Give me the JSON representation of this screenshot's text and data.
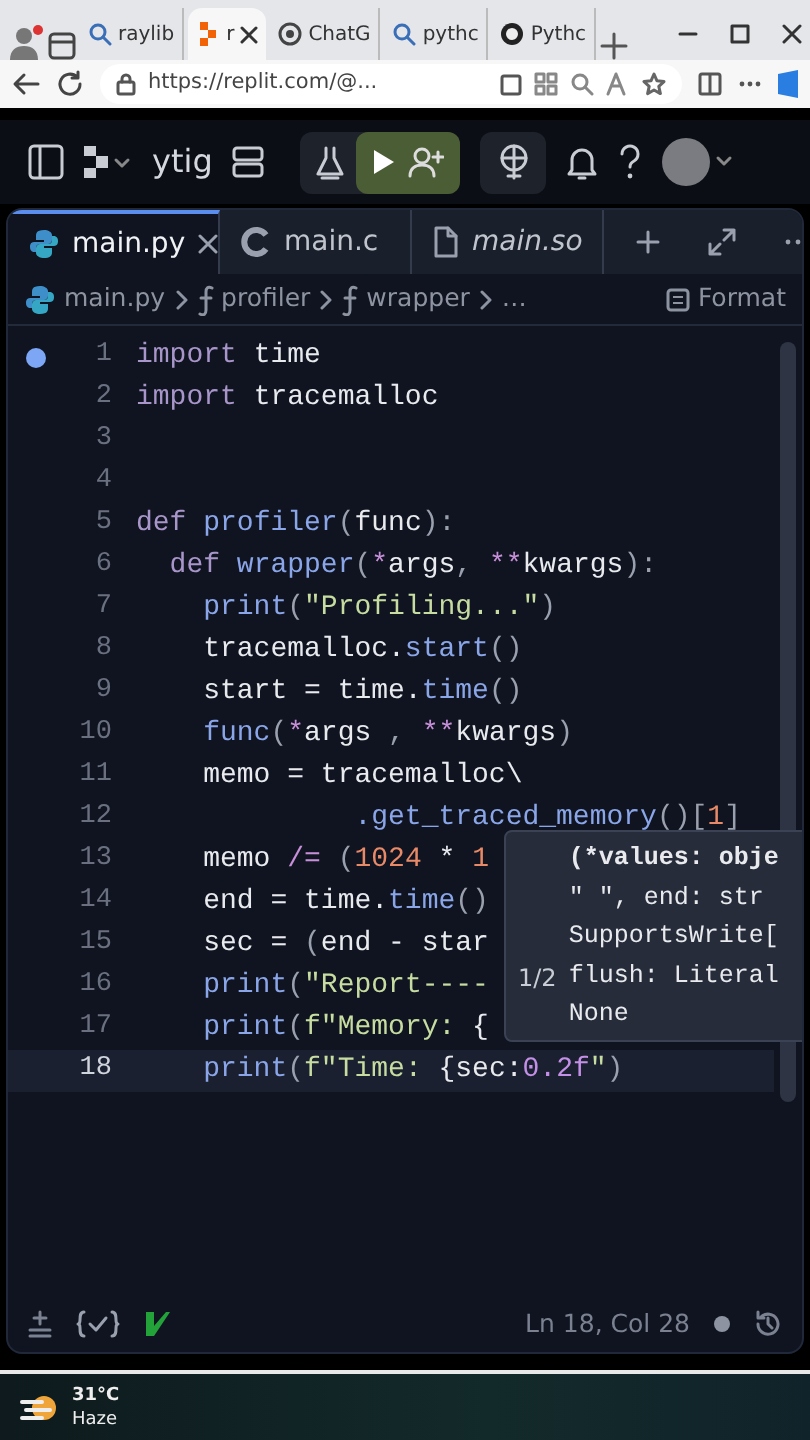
{
  "browser": {
    "tabs": [
      {
        "title": "raylib",
        "kind": "search",
        "selected": false
      },
      {
        "title": "r",
        "kind": "replit",
        "selected": true
      },
      {
        "title": "ChatG",
        "kind": "chatgpt",
        "selected": false
      },
      {
        "title": "pythc",
        "kind": "search",
        "selected": false
      },
      {
        "title": "Pythc",
        "kind": "github",
        "selected": false
      }
    ],
    "address": "https://replit.com/@..."
  },
  "header": {
    "repl_name": "ytig"
  },
  "editor_tabs": [
    {
      "label": "main.py",
      "kind": "python",
      "selected": true,
      "preview": false
    },
    {
      "label": "main.c",
      "kind": "c",
      "selected": false,
      "preview": false
    },
    {
      "label": "main.so",
      "kind": "file",
      "selected": false,
      "preview": true
    }
  ],
  "breadcrumb": [
    {
      "label": "main.py",
      "kind": "file"
    },
    {
      "label": "profiler",
      "kind": "function"
    },
    {
      "label": "wrapper",
      "kind": "function"
    },
    {
      "label": "…",
      "kind": "more"
    }
  ],
  "format_button": "Format",
  "code_lines": [
    {
      "number": "1",
      "dot": true,
      "selected": false,
      "tokens": [
        {
          "kind": "kw",
          "text": "import"
        },
        {
          "kind": "plain",
          "text": " time"
        }
      ]
    },
    {
      "number": "2",
      "dot": false,
      "selected": false,
      "tokens": [
        {
          "kind": "kw",
          "text": "import"
        },
        {
          "kind": "plain",
          "text": " tracemalloc"
        }
      ]
    },
    {
      "number": "3",
      "dot": false,
      "selected": false
    },
    {
      "number": "4",
      "dot": false,
      "selected": false
    },
    {
      "number": "5",
      "dot": false,
      "selected": false,
      "tokens": [
        {
          "kind": "kw",
          "text": "def"
        },
        {
          "kind": "fn",
          "text": " profiler"
        },
        {
          "kind": "punct",
          "text": "("
        },
        {
          "kind": "plain",
          "text": "func"
        },
        {
          "kind": "punct",
          "text": "):"
        }
      ]
    },
    {
      "number": "6",
      "dot": false,
      "selected": false,
      "tokens": [
        {
          "kind": "kw",
          "text": "  def"
        },
        {
          "kind": "fn",
          "text": " wrapper"
        },
        {
          "kind": "punct",
          "text": "("
        },
        {
          "kind": "op",
          "text": "*"
        },
        {
          "kind": "plain",
          "text": "args"
        },
        {
          "kind": "punct",
          "text": ", "
        },
        {
          "kind": "op",
          "text": "**"
        },
        {
          "kind": "plain",
          "text": "kwargs"
        },
        {
          "kind": "punct",
          "text": "):"
        }
      ]
    },
    {
      "number": "7",
      "dot": false,
      "selected": false,
      "tokens": [
        {
          "kind": "fn",
          "text": "    print"
        },
        {
          "kind": "punct",
          "text": "("
        },
        {
          "kind": "str",
          "text": "\"Profiling...\""
        },
        {
          "kind": "punct",
          "text": ")"
        }
      ]
    },
    {
      "number": "8",
      "dot": false,
      "selected": false,
      "tokens": [
        {
          "kind": "plain",
          "text": "    tracemalloc."
        },
        {
          "kind": "fn",
          "text": "start"
        },
        {
          "kind": "punct",
          "text": "()"
        }
      ]
    },
    {
      "number": "9",
      "dot": false,
      "selected": false,
      "tokens": [
        {
          "kind": "plain",
          "text": "    start = time."
        },
        {
          "kind": "fn",
          "text": "time"
        },
        {
          "kind": "punct",
          "text": "()"
        }
      ]
    },
    {
      "number": "10",
      "dot": false,
      "selected": false,
      "tokens": [
        {
          "kind": "fn",
          "text": "    func"
        },
        {
          "kind": "punct",
          "text": "("
        },
        {
          "kind": "op",
          "text": "*"
        },
        {
          "kind": "plain",
          "text": "args "
        },
        {
          "kind": "punct",
          "text": ", "
        },
        {
          "kind": "op",
          "text": "**"
        },
        {
          "kind": "plain",
          "text": "kwargs"
        },
        {
          "kind": "punct",
          "text": ")"
        }
      ]
    },
    {
      "number": "11",
      "dot": false,
      "selected": false,
      "tokens": [
        {
          "kind": "plain",
          "text": "    memo = tracemalloc\\"
        }
      ]
    },
    {
      "number": "12",
      "dot": false,
      "selected": false,
      "tokens": [
        {
          "kind": "fn",
          "text": "             .get_traced_memory"
        },
        {
          "kind": "punct",
          "text": "()["
        },
        {
          "kind": "num",
          "text": "1"
        },
        {
          "kind": "punct",
          "text": "]"
        }
      ]
    },
    {
      "number": "13",
      "dot": false,
      "selected": false,
      "tokens": [
        {
          "kind": "plain",
          "text": "    memo "
        },
        {
          "kind": "op",
          "text": "/="
        },
        {
          "kind": "punct",
          "text": " ("
        },
        {
          "kind": "num",
          "text": "1024"
        },
        {
          "kind": "plain",
          "text": " * "
        },
        {
          "kind": "num",
          "text": "1"
        }
      ]
    },
    {
      "number": "14",
      "dot": false,
      "selected": false,
      "tokens": [
        {
          "kind": "plain",
          "text": "    end = time."
        },
        {
          "kind": "fn",
          "text": "time"
        },
        {
          "kind": "punct",
          "text": "()"
        }
      ]
    },
    {
      "number": "15",
      "dot": false,
      "selected": false,
      "tokens": [
        {
          "kind": "plain",
          "text": "    sec = "
        },
        {
          "kind": "punct",
          "text": "("
        },
        {
          "kind": "plain",
          "text": "end - star"
        }
      ]
    },
    {
      "number": "16",
      "dot": false,
      "selected": false,
      "tokens": [
        {
          "kind": "fn",
          "text": "    print"
        },
        {
          "kind": "punct",
          "text": "("
        },
        {
          "kind": "str",
          "text": "\"Report----"
        }
      ]
    },
    {
      "number": "17",
      "dot": false,
      "selected": false,
      "tokens": [
        {
          "kind": "fn",
          "text": "    print"
        },
        {
          "kind": "punct",
          "text": "("
        },
        {
          "kind": "str",
          "text": "f\"Memory: "
        },
        {
          "kind": "plain",
          "text": "{"
        }
      ]
    },
    {
      "number": "18",
      "dot": false,
      "selected": true,
      "tokens": [
        {
          "kind": "fn",
          "text": "    print"
        },
        {
          "kind": "punct",
          "text": "("
        },
        {
          "kind": "str",
          "text": "f\"Time: "
        },
        {
          "kind": "plain",
          "text": "{sec:"
        },
        {
          "kind": "fmt",
          "text": "0.2f"
        },
        {
          "kind": "str",
          "text": "\""
        },
        {
          "kind": "punct",
          "text": ")"
        }
      ]
    }
  ],
  "hover_card": {
    "counter": "1/2",
    "lines": [
      {
        "text": "(*values: obje",
        "bold": true
      },
      {
        "text": "\" \", end: str",
        "bold": false
      },
      {
        "text": "SupportsWrite[",
        "bold": false
      },
      {
        "text": "flush: Literal",
        "bold": false
      },
      {
        "text": "None",
        "bold": false
      }
    ]
  },
  "status_bar": {
    "cursor": "Ln 18, Col 28"
  },
  "taskbar": {
    "temperature": "31°C",
    "weather": "Haze"
  }
}
